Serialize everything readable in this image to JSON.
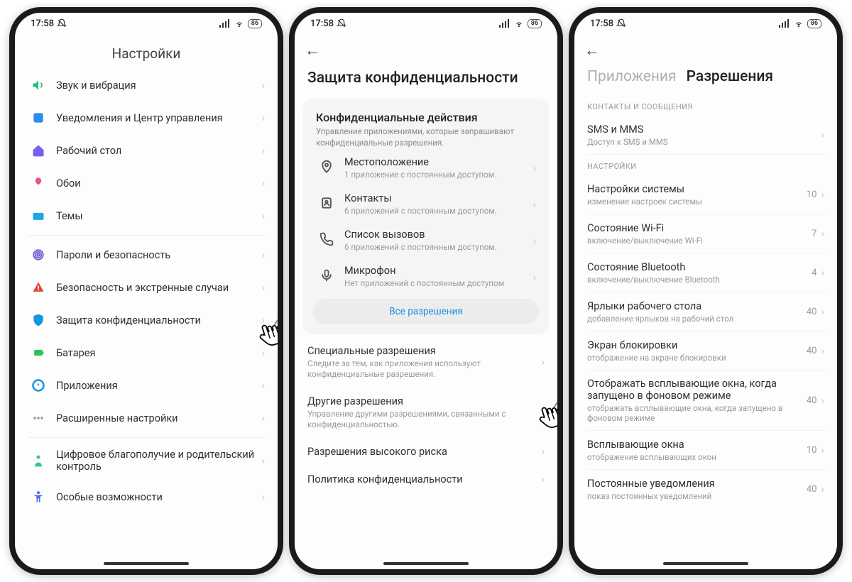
{
  "status": {
    "time": "17:58",
    "battery": "86"
  },
  "phone1": {
    "title": "Настройки",
    "groups": [
      [
        {
          "label": "Звук и вибрация",
          "icon": "volume",
          "color": "#28c17a"
        },
        {
          "label": "Уведомления и Центр управления",
          "icon": "notify",
          "color": "#2a8ef0"
        },
        {
          "label": "Рабочий стол",
          "icon": "home",
          "color": "#7a5ef0"
        },
        {
          "label": "Обои",
          "icon": "wallpaper",
          "color": "#e94f8c"
        },
        {
          "label": "Темы",
          "icon": "themes",
          "color": "#19a9e6"
        }
      ],
      [
        {
          "label": "Пароли и безопасность",
          "icon": "fingerprint",
          "color": "#6a5acd"
        },
        {
          "label": "Безопасность и экстренные случаи",
          "icon": "alert",
          "color": "#e0443f"
        },
        {
          "label": "Защита конфиденциальности",
          "icon": "shield",
          "color": "#1793e6",
          "cursor": true
        },
        {
          "label": "Батарея",
          "icon": "battery",
          "color": "#30c254"
        },
        {
          "label": "Приложения",
          "icon": "apps",
          "color": "#1793e6"
        },
        {
          "label": "Расширенные настройки",
          "icon": "more",
          "color": "#9aa0a6"
        }
      ],
      [
        {
          "label": "Цифровое благополучие и родительский контроль",
          "icon": "wellbeing",
          "color": "#3cc48e"
        },
        {
          "label": "Особые возможности",
          "icon": "accessibility",
          "color": "#4a6ee0"
        }
      ]
    ]
  },
  "phone2": {
    "title": "Защита конфиденциальности",
    "card": {
      "title": "Конфиденциальные действия",
      "sub": "Управление приложениями, которые запрашивают конфиденциальные разрешения.",
      "items": [
        {
          "label": "Местоположение",
          "sub": "1 приложение с постоянным доступом.",
          "icon": "location"
        },
        {
          "label": "Контакты",
          "sub": "6 приложений с постоянным доступом.",
          "icon": "contacts"
        },
        {
          "label": "Список вызовов",
          "sub": "6 приложений с постоянным доступом.",
          "icon": "calls"
        },
        {
          "label": "Микрофон",
          "sub": "Нет приложений с постоянным доступом",
          "icon": "mic"
        }
      ],
      "all_button": "Все разрешения"
    },
    "below": [
      {
        "title": "Специальные разрешения",
        "sub": "Следите за тем, как приложения используют конфиденциальные разрешения."
      },
      {
        "title": "Другие разрешения",
        "sub": "Управление другими разрешениями, связанными с конфиденциальностью.",
        "cursor": true
      },
      {
        "title": "Разрешения высокого риска",
        "sub": ""
      },
      {
        "title": "Политика конфиденциальности",
        "sub": ""
      }
    ]
  },
  "phone3": {
    "tab_inactive": "Приложения",
    "tab_active": "Разрешения",
    "section1": "КОНТАКТЫ И СООБЩЕНИЯ",
    "contacts_item": {
      "title": "SMS и MMS",
      "sub": "Доступ к SMS и MMS"
    },
    "section2": "НАСТРОЙКИ",
    "items": [
      {
        "title": "Настройки системы",
        "sub": "изменение настроек системы",
        "count": 10
      },
      {
        "title": "Состояние Wi-Fi",
        "sub": "включение/выключение Wi-Fi",
        "count": 7
      },
      {
        "title": "Состояние Bluetooth",
        "sub": "включение/выключение Bluetooth",
        "count": 4
      },
      {
        "title": "Ярлыки рабочего стола",
        "sub": "добавление ярлыков на рабочий стол",
        "count": 40
      },
      {
        "title": "Экран блокировки",
        "sub": "отображение на экране блокировки",
        "count": 40
      },
      {
        "title": "Отображать всплывающие окна, когда запущено в фоновом режиме",
        "sub": "отображать всплывающие окна, когда запущено в фоновом режиме",
        "count": 40
      },
      {
        "title": "Всплывающие окна",
        "sub": "отображение всплывающих окон",
        "count": 10
      },
      {
        "title": "Постоянные уведомления",
        "sub": "показ постоянных уведомлений",
        "count": 40
      }
    ]
  }
}
